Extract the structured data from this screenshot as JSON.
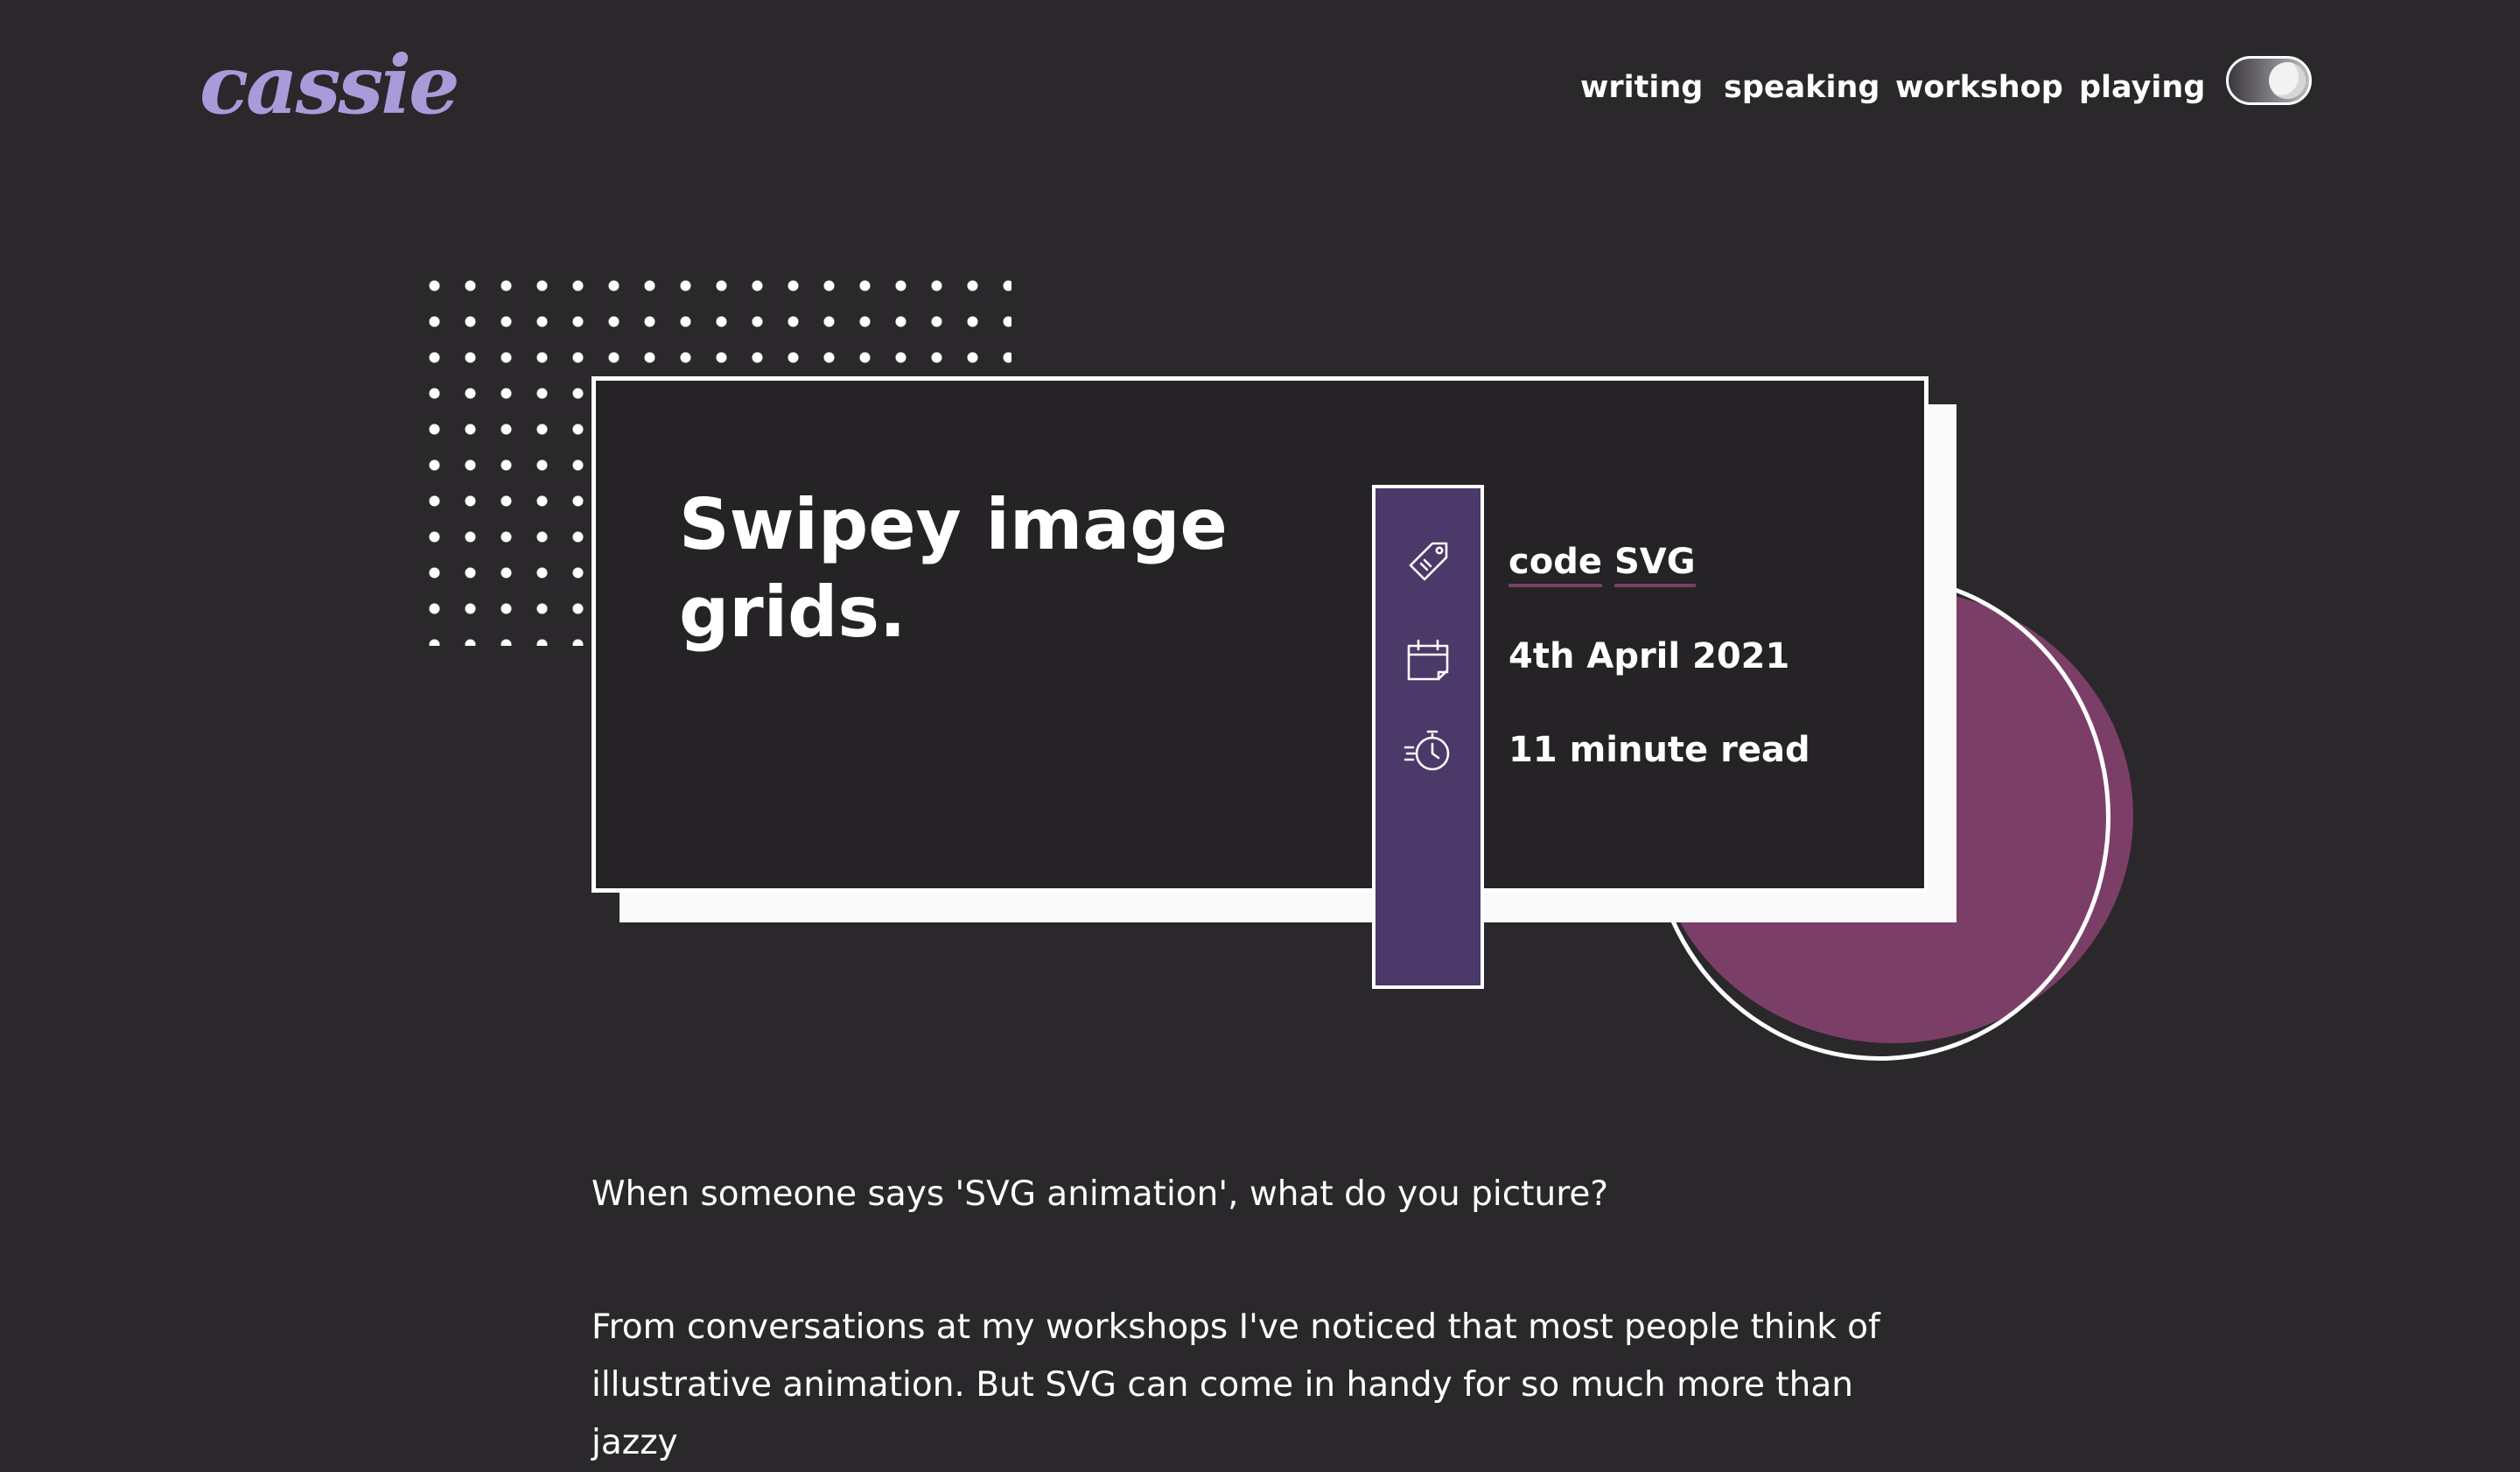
{
  "site": {
    "logo": "cassie"
  },
  "nav": {
    "items": [
      {
        "label": "writing"
      },
      {
        "label": "speaking"
      },
      {
        "label": "workshop"
      },
      {
        "label": "playing"
      }
    ],
    "theme_toggle": {
      "state": "on"
    }
  },
  "post": {
    "title": "Swipey image grids.",
    "tags": [
      "code",
      "SVG"
    ],
    "date": "4th April 2021",
    "read_time": "11 minute read"
  },
  "content": {
    "paragraphs": [
      "When someone says 'SVG animation', what do you picture?",
      "From conversations at my workshops I've noticed that most people think of illustrative animation. But SVG can come in handy for so much more than jazzy"
    ]
  },
  "icons": {
    "tag": "tag-icon",
    "date": "calendar-icon",
    "read_time": "stopwatch-icon"
  },
  "colors": {
    "background": "#2a282b",
    "logo": "#a99ad9",
    "meta_bar": "#4b3969",
    "circle": "#7b3f67",
    "card": "#252326"
  }
}
